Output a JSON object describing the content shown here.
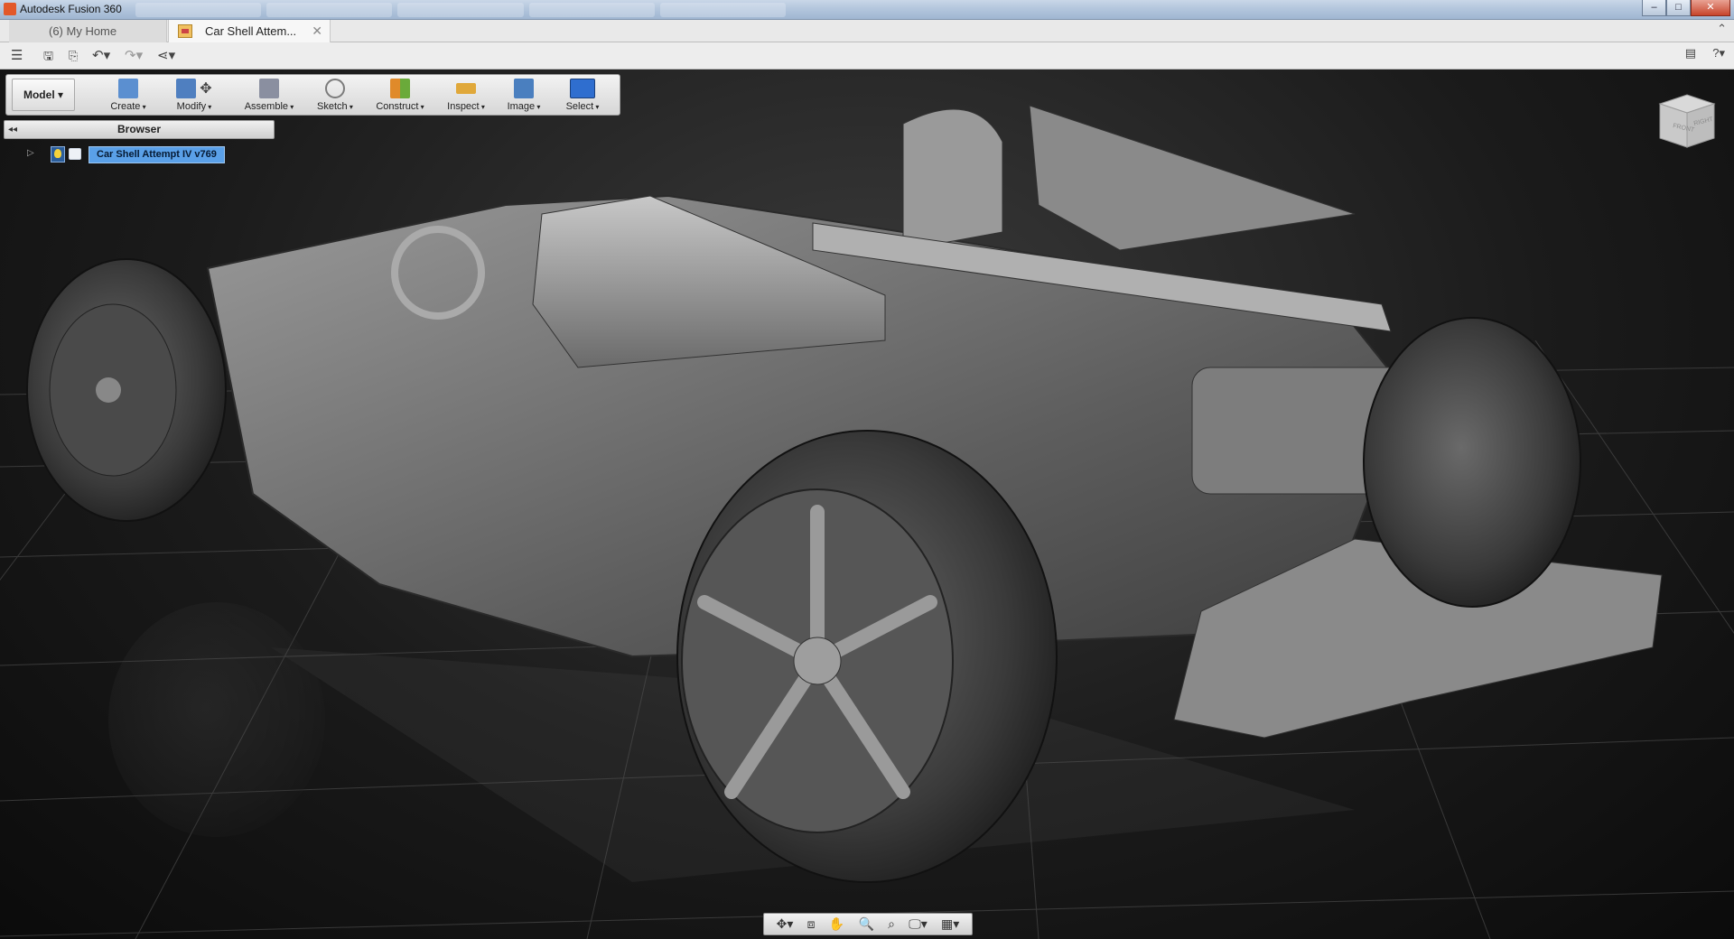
{
  "window": {
    "app_title": "Autodesk Fusion 360",
    "controls": {
      "minimize": "–",
      "maximize": "□",
      "close": "✕"
    }
  },
  "tabs": [
    {
      "label": "(6) My Home"
    },
    {
      "label": "Car Shell Attem...",
      "close": "✕",
      "active": true
    }
  ],
  "tabstrip": {
    "collapse": "⌃"
  },
  "quick_access": {
    "menu": "☰",
    "save": "🖫",
    "save_as": "⎘",
    "undo": "↶▾",
    "redo": "↷▾",
    "share": "⋖▾",
    "comments": "▤",
    "help": "?▾"
  },
  "ribbon": {
    "workspace": "Model ▾",
    "groups": [
      {
        "label": "Create",
        "icon": "create-icon",
        "color": "#5b8fd0"
      },
      {
        "label": "Modify",
        "icon": "modify-icon",
        "color": "#4f7fc0"
      },
      {
        "label": "Assemble",
        "icon": "assemble-icon",
        "color": "#8a8fa0"
      },
      {
        "label": "Sketch",
        "icon": "sketch-icon",
        "color": "#7b7b7b"
      },
      {
        "label": "Construct",
        "icon": "construct-icon",
        "color": "#e08a2a"
      },
      {
        "label": "Inspect",
        "icon": "inspect-icon",
        "color": "#e0a83a"
      },
      {
        "label": "Image",
        "icon": "image-icon",
        "color": "#4a7fbf"
      },
      {
        "label": "Select",
        "icon": "select-icon",
        "color": "#2f6ecf"
      }
    ]
  },
  "browser": {
    "title": "Browser",
    "collapse": "◂◂",
    "root": {
      "label": "Car Shell Attempt IV v769",
      "expander": "▷"
    }
  },
  "viewcube": {
    "front": "FRONT",
    "right": "RIGHT"
  },
  "navbar": {
    "orbit": "✥▾",
    "look_at": "⧈",
    "pan": "✋",
    "zoom_window": "🔍",
    "fit": "⌕",
    "display": "🖵▾",
    "grid": "▦▾"
  },
  "colors": {
    "accent": "#5aa0e8",
    "viewport_bg": "#1b1b1b",
    "title_bar": "#b6c8de"
  }
}
